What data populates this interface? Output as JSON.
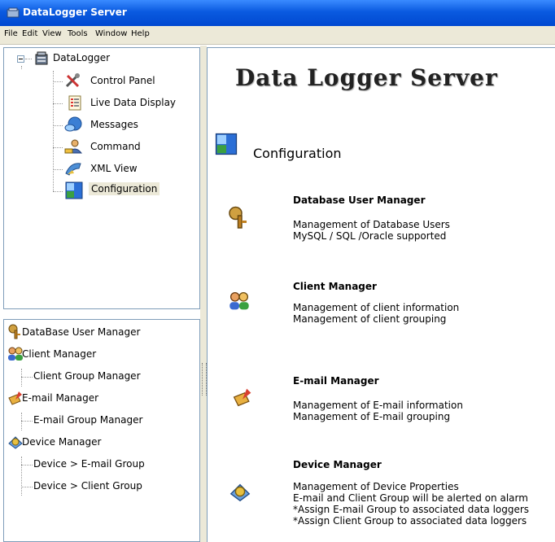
{
  "window": {
    "title": "DataLogger Server"
  },
  "menu": [
    "File",
    "Edit",
    "View",
    "Tools",
    "Window",
    "Help"
  ],
  "tree": {
    "root": "DataLogger",
    "items": [
      "Control Panel",
      "Live Data Display",
      "Messages",
      "Command",
      "XML View",
      "Configuration"
    ],
    "selected": "Configuration"
  },
  "list": {
    "items": [
      "DataBase User Manager",
      "Client Manager",
      "Client Group Manager",
      "E-mail Manager",
      "E-mail Group Manager",
      "Device Manager",
      "Device > E-mail Group",
      "Device > Client Group"
    ]
  },
  "content": {
    "header": "Data Logger Server",
    "section": "Configuration",
    "features": [
      {
        "title": "Database User  Manager",
        "lines": [
          "Management of Database Users",
          "MySQL / SQL /Oracle supported"
        ]
      },
      {
        "title": "Client Manager",
        "lines": [
          "Management of client information",
          "Management of client grouping"
        ]
      },
      {
        "title": "E-mail Manager",
        "lines": [
          "Management of E-mail information",
          "Management of E-mail grouping"
        ]
      },
      {
        "title": "Device Manager",
        "lines": [
          "Management of Device Properties",
          "E-mail and Client Group will be alerted on alarm",
          "*Assign E-mail Group to associated data loggers",
          "*Assign Client Group to associated data loggers"
        ]
      }
    ]
  }
}
